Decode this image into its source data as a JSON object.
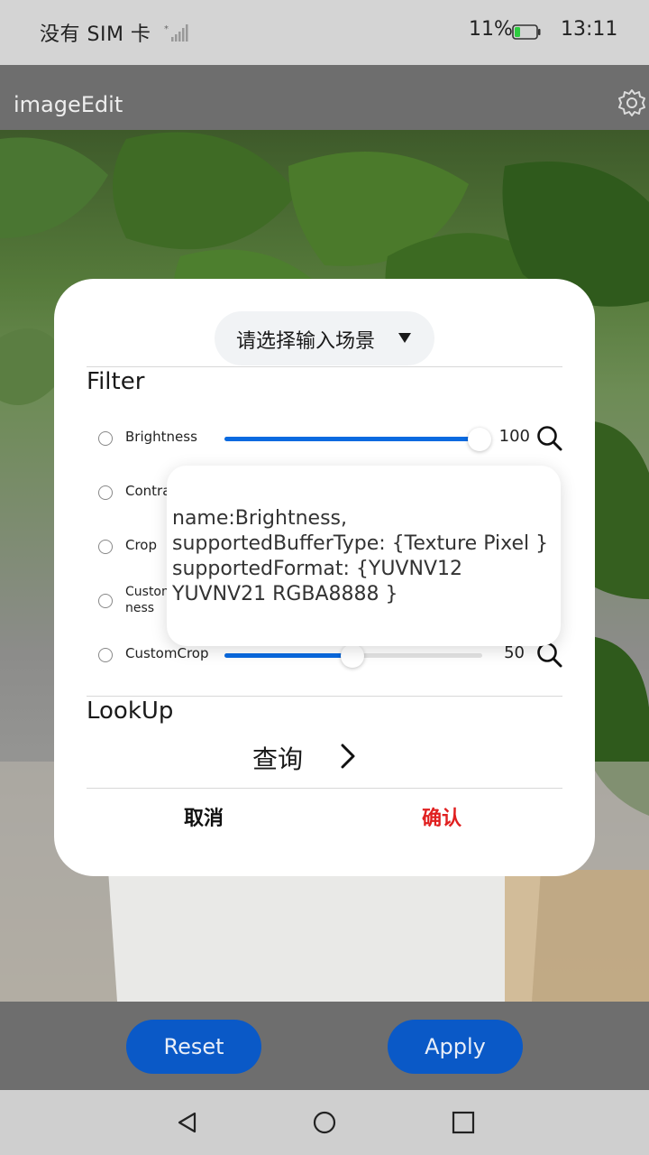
{
  "status_bar": {
    "carrier": "没有 SIM 卡",
    "battery_percent": "11%",
    "time": "13:11",
    "battery_color": "#2ecc40"
  },
  "app_bar": {
    "title": "imageEdit",
    "settings_icon": "gear-icon"
  },
  "dialog": {
    "scene_select": "请选择输入场景",
    "filter_section": "Filter",
    "filters": [
      {
        "label": "Brightness",
        "value": "100",
        "level": 1.0
      },
      {
        "label": "Contra",
        "value": "",
        "level": 0.5
      },
      {
        "label": "Crop",
        "value": "",
        "level": 0.5
      },
      {
        "label": "Custom ness",
        "value": "",
        "level": 0.5
      },
      {
        "label": "CustomCrop",
        "value": "50",
        "level": 0.5
      }
    ],
    "tooltip": "name:Brightness, supportedBufferType: {Texture Pixel } supportedFormat: {YUVNV12 YUVNV21 RGBA8888 }",
    "lookup_section": "LookUp",
    "query_label": "查询",
    "cancel": "取消",
    "confirm": "确认",
    "accent_color": "#0a6ae0",
    "confirm_color": "#e02020"
  },
  "actions": {
    "reset": "Reset",
    "apply": "Apply"
  },
  "nav_bar": {
    "back_icon": "back-triangle-icon",
    "home_icon": "home-circle-icon",
    "recents_icon": "recents-square-icon"
  }
}
